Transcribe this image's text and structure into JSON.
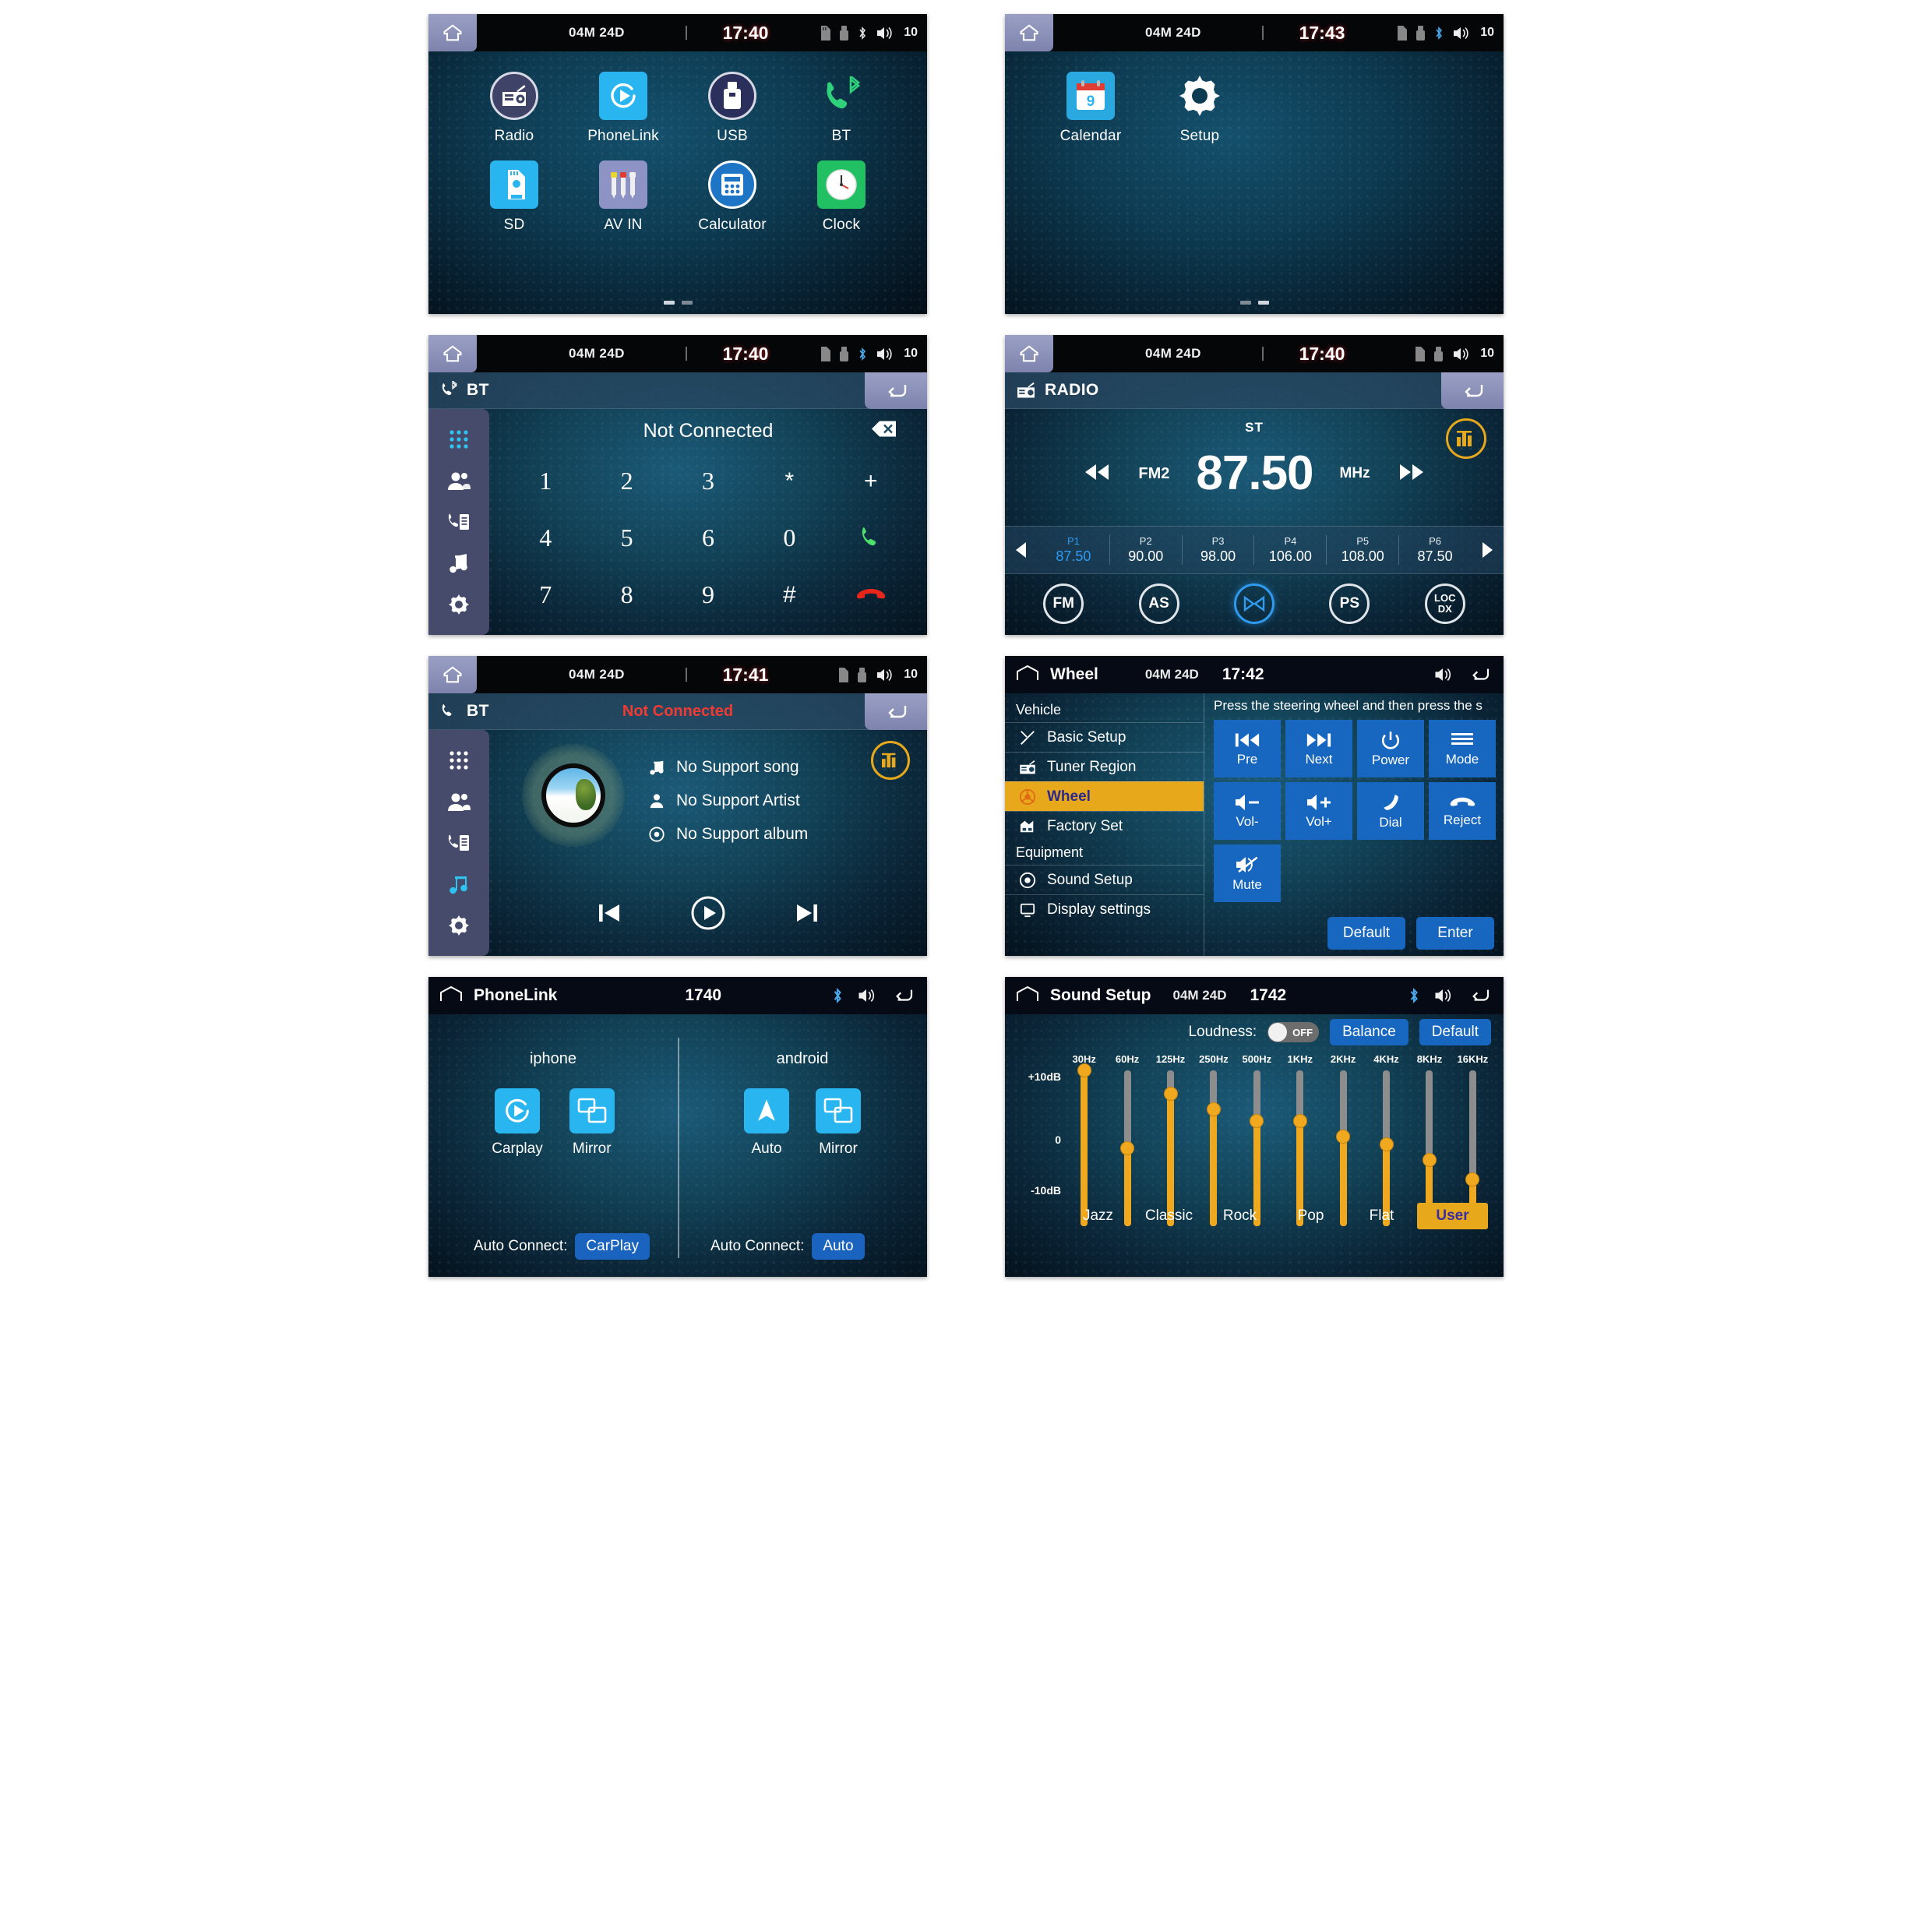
{
  "home": {
    "status": {
      "date": "04M 24D",
      "time": "17:40",
      "volume": "10"
    },
    "page1_apps": [
      {
        "label": "Radio",
        "icon": "radio-icon"
      },
      {
        "label": "PhoneLink",
        "icon": "phonelink-icon"
      },
      {
        "label": "USB",
        "icon": "usb-icon"
      },
      {
        "label": "BT",
        "icon": "bluetooth-phone-icon"
      },
      {
        "label": "SD",
        "icon": "sd-card-icon"
      },
      {
        "label": "AV IN",
        "icon": "av-in-icon"
      },
      {
        "label": "Calculator",
        "icon": "calculator-icon"
      },
      {
        "label": "Clock",
        "icon": "clock-icon"
      }
    ],
    "page2": {
      "status": {
        "date": "04M 24D",
        "time": "17:43",
        "volume": "10"
      },
      "apps": [
        {
          "label": "Calendar",
          "icon": "calendar-icon"
        },
        {
          "label": "Setup",
          "icon": "gear-icon"
        }
      ]
    }
  },
  "bt_dialer": {
    "status": {
      "date": "04M 24D",
      "time": "17:40",
      "volume": "10"
    },
    "header_title": "BT",
    "connection_status": "Not Connected",
    "keys": [
      "1",
      "2",
      "3",
      "*",
      "+",
      "4",
      "5",
      "6",
      "0",
      "call",
      "7",
      "8",
      "9",
      "#",
      "hangup"
    ],
    "rail": [
      "keypad-icon",
      "contacts-icon",
      "call-history-icon",
      "music-icon",
      "settings-icon"
    ]
  },
  "radio": {
    "status": {
      "date": "04M 24D",
      "time": "17:40",
      "volume": "10"
    },
    "header_title": "RADIO",
    "stereo_label": "ST",
    "band": "FM2",
    "frequency": "87.50",
    "unit": "MHz",
    "presets": [
      {
        "name": "P1",
        "freq": "87.50",
        "active": true
      },
      {
        "name": "P2",
        "freq": "90.00",
        "active": false
      },
      {
        "name": "P3",
        "freq": "98.00",
        "active": false
      },
      {
        "name": "P4",
        "freq": "106.00",
        "active": false
      },
      {
        "name": "P5",
        "freq": "108.00",
        "active": false
      },
      {
        "name": "P6",
        "freq": "87.50",
        "active": false
      }
    ],
    "buttons": [
      {
        "label": "FM",
        "active": false
      },
      {
        "label": "AS",
        "active": false
      },
      {
        "label": "ST",
        "active": true,
        "icon": "stereo-icon"
      },
      {
        "label": "PS",
        "active": false
      },
      {
        "label": "LOC\nDX",
        "active": false
      }
    ]
  },
  "bt_music": {
    "status": {
      "date": "04M 24D",
      "time": "17:41",
      "volume": "10"
    },
    "header_title": "BT",
    "connection_status": "Not Connected",
    "song": "No Support song",
    "artist": "No Support Artist",
    "album": "No Support album"
  },
  "wheel": {
    "status": {
      "title": "Wheel",
      "date": "04M 24D",
      "time": "17:42"
    },
    "menu": {
      "group1": "Vehicle",
      "group2": "Equipment",
      "items1": [
        {
          "label": "Basic Setup",
          "icon": "tools-icon",
          "active": false
        },
        {
          "label": "Tuner Region",
          "icon": "radio-icon",
          "active": false
        },
        {
          "label": "Wheel",
          "icon": "steering-wheel-icon",
          "active": true
        },
        {
          "label": "Factory Set",
          "icon": "factory-icon",
          "active": false
        }
      ],
      "items2": [
        {
          "label": "Sound Setup",
          "icon": "speaker-icon",
          "active": false
        },
        {
          "label": "Display settings",
          "icon": "display-icon",
          "active": false
        }
      ]
    },
    "note": "Press the steering wheel and then press the s",
    "buttons": [
      {
        "label": "Pre",
        "icon": "skip-previous-icon"
      },
      {
        "label": "Next",
        "icon": "skip-next-icon"
      },
      {
        "label": "Power",
        "icon": "power-icon"
      },
      {
        "label": "Mode",
        "icon": "menu-lines-icon"
      },
      {
        "label": "Vol-",
        "icon": "volume-down-icon"
      },
      {
        "label": "Vol+",
        "icon": "volume-up-icon"
      },
      {
        "label": "Dial",
        "icon": "phone-dial-icon"
      },
      {
        "label": "Reject",
        "icon": "phone-hangup-icon"
      },
      {
        "label": "Mute",
        "icon": "mute-icon"
      }
    ],
    "actions": {
      "default": "Default",
      "enter": "Enter"
    }
  },
  "phonelink": {
    "status": {
      "title": "PhoneLink",
      "time": "1740"
    },
    "left": {
      "title": "iphone",
      "items": [
        {
          "label": "Carplay",
          "icon": "carplay-icon"
        },
        {
          "label": "Mirror",
          "icon": "mirror-icon"
        }
      ],
      "auto_label": "Auto Connect:",
      "auto_value": "CarPlay"
    },
    "right": {
      "title": "android",
      "items": [
        {
          "label": "Auto",
          "icon": "android-auto-icon"
        },
        {
          "label": "Mirror",
          "icon": "mirror-icon"
        }
      ],
      "auto_label": "Auto Connect:",
      "auto_value": "Auto"
    }
  },
  "sound_setup": {
    "status": {
      "title": "Sound Setup",
      "date": "04M 24D",
      "time": "1742"
    },
    "loudness_label": "Loudness:",
    "loudness_value": "OFF",
    "balance_label": "Balance",
    "default_label": "Default",
    "presets": [
      {
        "label": "Jazz",
        "active": false
      },
      {
        "label": "Classic",
        "active": false
      },
      {
        "label": "Rock",
        "active": false
      },
      {
        "label": "Pop",
        "active": false
      },
      {
        "label": "Flat",
        "active": false
      },
      {
        "label": "User",
        "active": true
      }
    ],
    "chart_data": {
      "type": "bar",
      "title": "Equalizer",
      "categories": [
        "30Hz",
        "60Hz",
        "125Hz",
        "250Hz",
        "500Hz",
        "1KHz",
        "2KHz",
        "4KHz",
        "8KHz",
        "16KHz"
      ],
      "values": [
        10,
        0,
        7,
        5,
        3.5,
        3.5,
        1.5,
        0.5,
        -1.5,
        -4
      ],
      "ylabel": "dB",
      "ylim": [
        -10,
        10
      ],
      "ytick_labels": [
        "+10dB",
        "0",
        "-10dB"
      ],
      "ytick_values": [
        10,
        0,
        -10
      ]
    }
  }
}
